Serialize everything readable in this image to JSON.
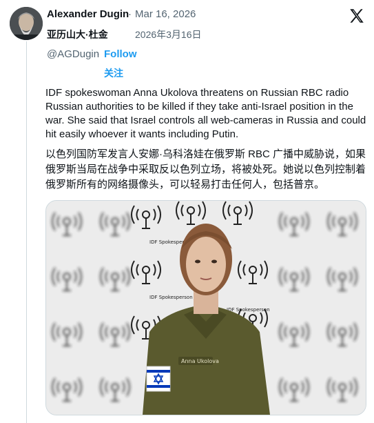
{
  "author": {
    "name": "Alexander Dugin",
    "name_zh": "亚历山大·杜金",
    "handle": "@AGDugin",
    "follow_label": "Follow",
    "follow_label_zh": "关注"
  },
  "post": {
    "date": "Mar 16, 2026",
    "date_zh": "2026年3月16日",
    "separator": "·",
    "text_en": "IDF spokeswoman Anna Ukolova threatens on Russian RBC radio Russian authorities to be killed if they take anti-Israel position in the war. She said that Israel controls all web-cameras in Russia and could hit easily whoever  it wants including Putin.",
    "text_zh": "以色列国防军发言人安娜·乌科洛娃在俄罗斯 RBC 广播中威胁说，如果俄罗斯当局在战争中采取反以色列立场，将被处死。她说以色列控制着俄罗斯所有的网络摄像头，可以轻易打击任何人，包括普京。"
  },
  "media": {
    "backdrop_logo_text": "דובר צה״ל\nIDF Spokesperson",
    "name_tag": "Anna Ukolova"
  },
  "icons": {
    "brand": "x-logo-icon",
    "flag": "israel-flag-icon"
  },
  "colors": {
    "link": "#1d9bf0",
    "secondary_text": "#536471",
    "uniform": "#5a5a2e"
  }
}
